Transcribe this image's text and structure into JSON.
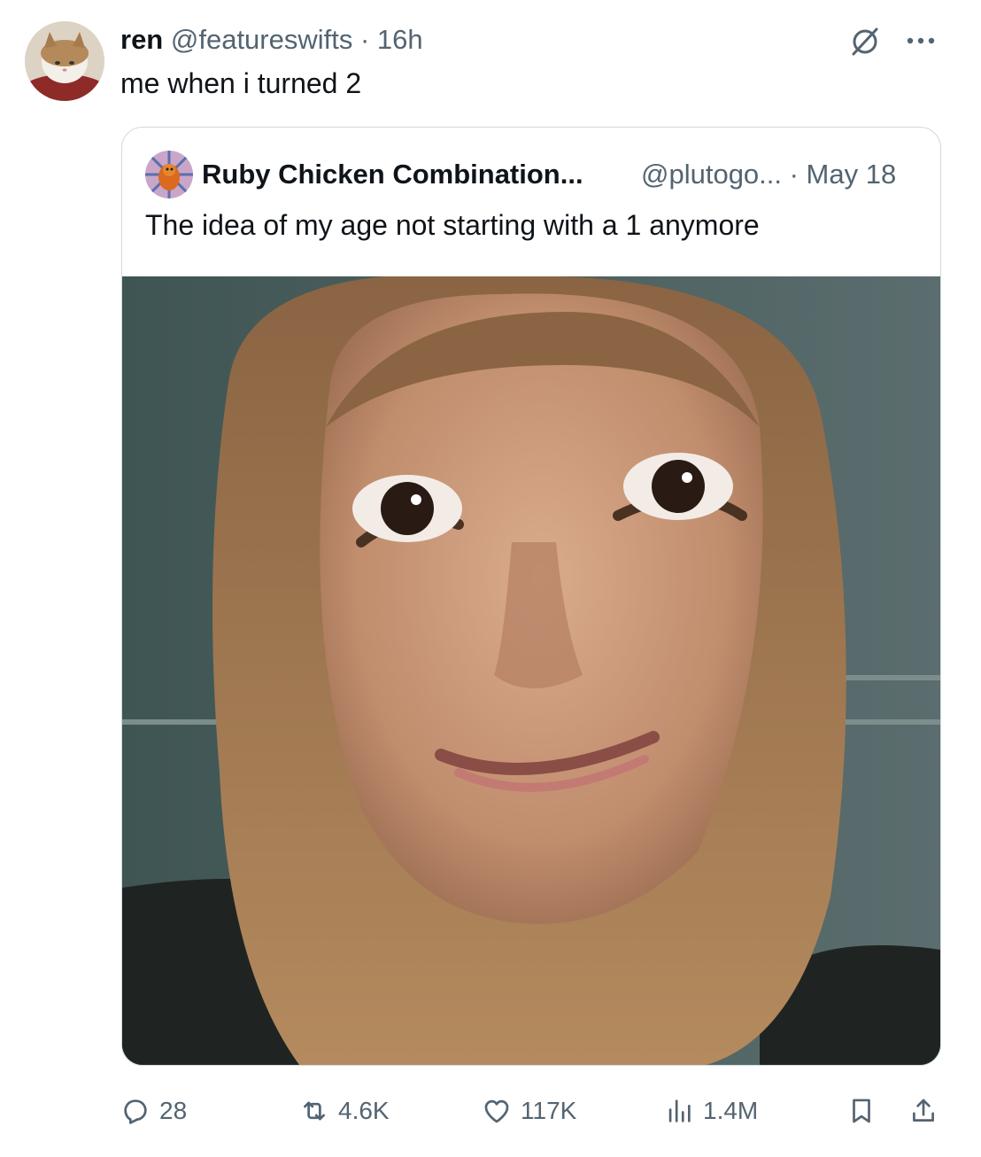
{
  "post": {
    "author_name": "ren",
    "author_handle": "@featureswifts",
    "time": "· 16h",
    "text": "me when i turned 2"
  },
  "quote": {
    "author_name": "Ruby Chicken Combination...",
    "author_handle": "@plutogo... · May 18",
    "text": "The idea of my age not starting with a 1 anymore"
  },
  "actions": {
    "replies": "28",
    "reposts": "4.6K",
    "likes": "117K",
    "views": "1.4M"
  },
  "icons": {
    "grok": "grok-icon",
    "more": "more-icon",
    "reply": "reply-icon",
    "repost": "repost-icon",
    "like": "heart-icon",
    "views": "views-icon",
    "bookmark": "bookmark-icon",
    "share": "share-icon"
  },
  "colors": {
    "text_primary": "#0f1419",
    "text_secondary": "#536471",
    "border": "#cfd9de"
  }
}
